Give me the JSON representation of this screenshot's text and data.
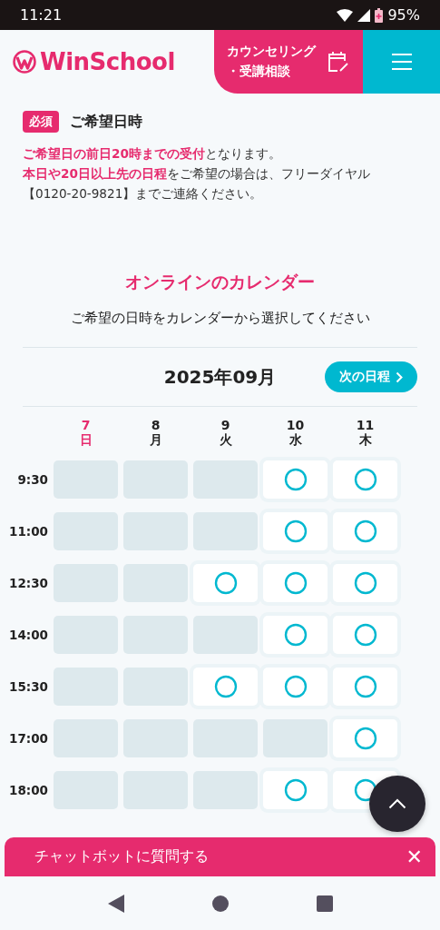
{
  "status_bar": {
    "time": "11:21",
    "battery": "95%"
  },
  "header": {
    "logo": "WinSchool",
    "counseling_button": {
      "line_1": "カウンセリング",
      "line_2": "・受講相談"
    }
  },
  "field": {
    "badge": "必須",
    "label": "ご希望日時",
    "notes": [
      "**ご希望日の前日20時までの受付**となります。",
      "**本日や20日以上先の日程**をご希望の場合は、フリーダイヤル【0120-20-9821】までご連絡ください。"
    ]
  },
  "calendar": {
    "title": "オンラインのカレンダー",
    "subtitle": "ご希望の日時をカレンダーから選択してください",
    "month": "2025年09月",
    "next_button": "次の日程",
    "days": [
      {
        "date": "7",
        "weekday": "日",
        "kind": "sunday"
      },
      {
        "date": "8",
        "weekday": "月",
        "kind": "weekday"
      },
      {
        "date": "9",
        "weekday": "火",
        "kind": "weekday"
      },
      {
        "date": "10",
        "weekday": "水",
        "kind": "weekday"
      },
      {
        "date": "11",
        "weekday": "木",
        "kind": "weekday"
      }
    ],
    "rows": [
      {
        "time": "9:30",
        "slots": [
          false,
          false,
          false,
          true,
          true
        ]
      },
      {
        "time": "11:00",
        "slots": [
          false,
          false,
          false,
          true,
          true
        ]
      },
      {
        "time": "12:30",
        "slots": [
          false,
          false,
          true,
          true,
          true
        ]
      },
      {
        "time": "14:00",
        "slots": [
          false,
          false,
          false,
          true,
          true
        ]
      },
      {
        "time": "15:30",
        "slots": [
          false,
          false,
          true,
          true,
          true
        ]
      },
      {
        "time": "17:00",
        "slots": [
          false,
          false,
          false,
          false,
          true
        ]
      },
      {
        "time": "18:00",
        "slots": [
          false,
          false,
          false,
          true,
          true
        ]
      }
    ]
  },
  "chat_bar": {
    "label": "チャットボットに質問する",
    "close": "✕"
  }
}
